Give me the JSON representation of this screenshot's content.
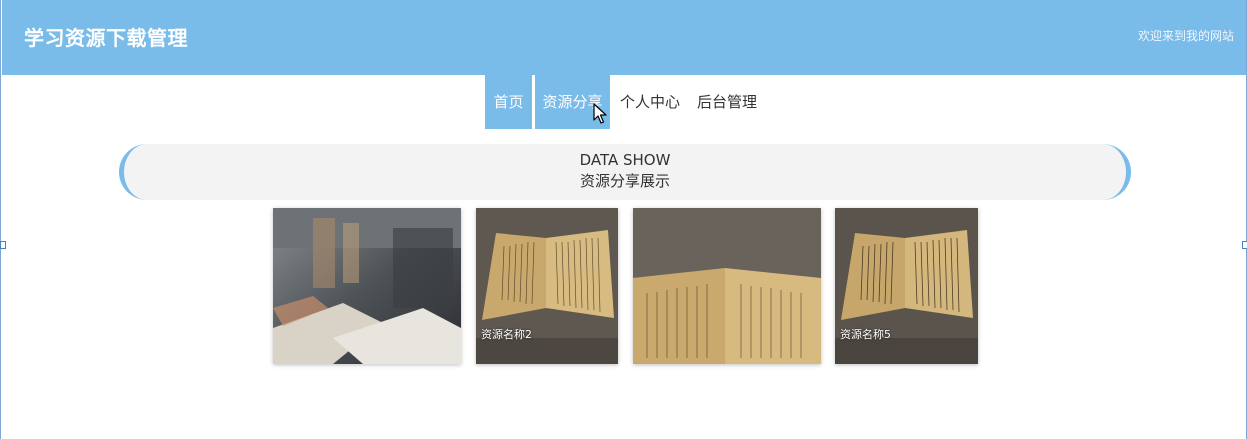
{
  "header": {
    "site_title": "学习资源下载管理",
    "welcome_text": "欢迎来到我的网站",
    "bg_color": "#79bbe9"
  },
  "nav": {
    "items": [
      {
        "label": "首页",
        "active": true
      },
      {
        "label": "资源分享",
        "active": true
      },
      {
        "label": "个人中心",
        "active": false
      },
      {
        "label": "后台管理",
        "active": false
      }
    ]
  },
  "banner": {
    "title_en": "DATA SHOW",
    "title_cn": "资源分享展示"
  },
  "cards": [
    {
      "caption": "",
      "image": "museum-display-photo"
    },
    {
      "caption": "资源名称2",
      "image": "old-book-photo"
    },
    {
      "caption": "",
      "image": "old-book-closeup-photo"
    },
    {
      "caption": "资源名称5",
      "image": "old-book-photo"
    }
  ]
}
